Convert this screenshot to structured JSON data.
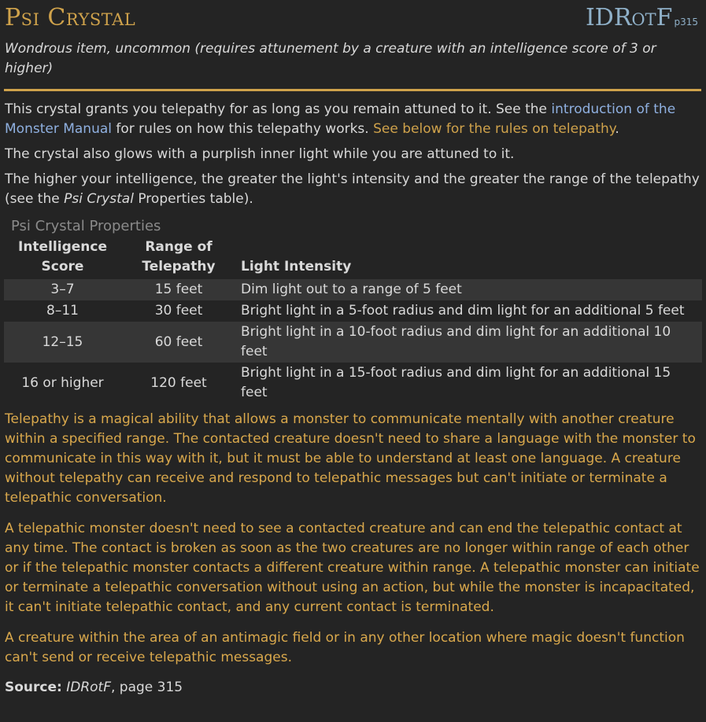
{
  "header": {
    "title": "Psi Crystal",
    "source_abbr": "IDRotF",
    "source_page": "p315",
    "subtitle": "Wondrous item, uncommon (requires attunement by a creature with an intelligence score of 3 or higher)"
  },
  "intro": {
    "p1_before": "This crystal grants you telepathy for as long as you remain attuned to it. See the ",
    "p1_link_mm": "introduction of the Monster Manual",
    "p1_middle": " for rules on how this telepathy works. ",
    "p1_link_below": "See below for the rules on telepathy",
    "p1_end": ".",
    "p2": "The crystal also glows with a purplish inner light while you are attuned to it.",
    "p3_before": "The higher your intelligence, the greater the light's intensity and the greater the range of the telepathy (see the ",
    "p3_italic": "Psi Crystal",
    "p3_after": " Properties table)."
  },
  "table": {
    "caption": "Psi Crystal Properties",
    "headers": [
      "Intelligence Score",
      "Range of Telepathy",
      "Light Intensity"
    ],
    "rows": [
      [
        "3–7",
        "15 feet",
        "Dim light out to a range of 5 feet"
      ],
      [
        "8–11",
        "30 feet",
        "Bright light in a 5-foot radius and dim light for an additional 5 feet"
      ],
      [
        "12–15",
        "60 feet",
        "Bright light in a 10-foot radius and dim light for an additional 10 feet"
      ],
      [
        "16 or higher",
        "120 feet",
        "Bright light in a 15-foot radius and dim light for an additional 15 feet"
      ]
    ]
  },
  "telepathy": {
    "p1": "Telepathy is a magical ability that allows a monster to communicate mentally with another creature within a specified range. The contacted creature doesn't need to share a language with the monster to communicate in this way with it, but it must be able to understand at least one language. A creature without telepathy can receive and respond to telepathic messages but can't initiate or terminate a telepathic conversation.",
    "p2": "A telepathic monster doesn't need to see a contacted creature and can end the telepathic contact at any time. The contact is broken as soon as the two creatures are no longer within range of each other or if the telepathic monster contacts a different creature within range. A telepathic monster can initiate or terminate a telepathic conversation without using an action, but while the monster is incapacitated, it can't initiate telepathic contact, and any current contact is terminated.",
    "p3": "A creature within the area of an antimagic field or in any other location where magic doesn't function can't send or receive telepathic messages."
  },
  "source": {
    "label": "Source:",
    "book": "IDRotF",
    "page_text": ", page 315"
  },
  "colors": {
    "background": "#242424",
    "title_gold": "#cfa24b",
    "source_blue": "#8fb0c8",
    "link_blue": "#8fb0e0",
    "telepathy_text": "#d9a84c",
    "row_shade": "#363636"
  }
}
